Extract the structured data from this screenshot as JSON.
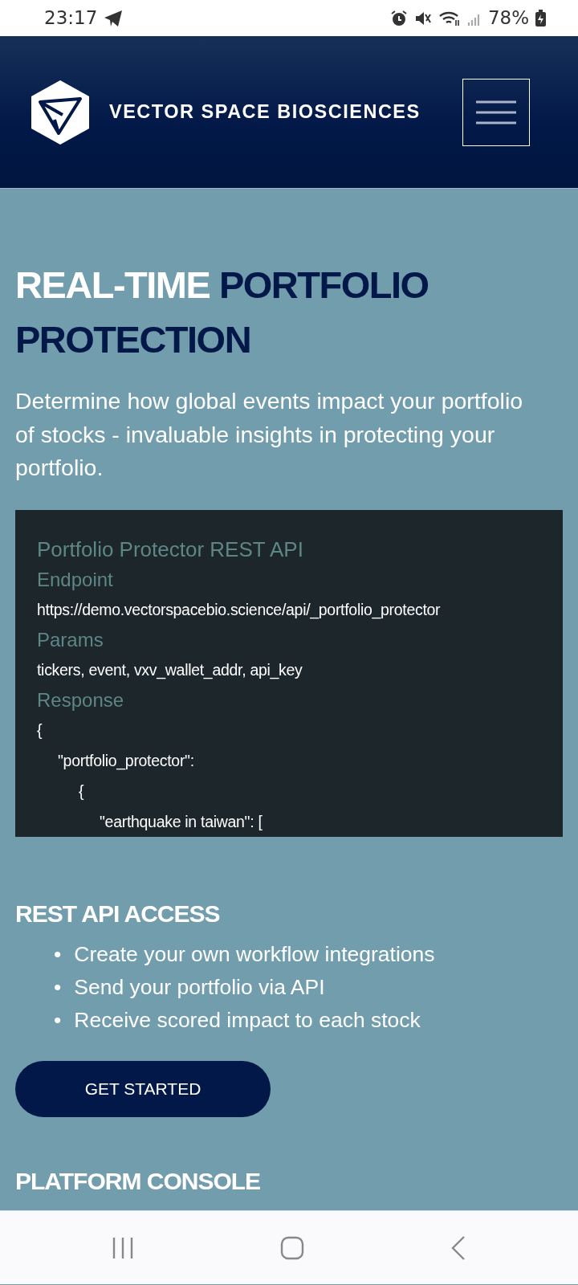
{
  "status_bar": {
    "time": "23:17",
    "battery": "78%"
  },
  "header": {
    "brand": "VECTOR SPACE BIOSCIENCES"
  },
  "hero": {
    "title_plain": "REAL-TIME",
    "title_accent": "PORTFOLIO PROTECTION",
    "description": "Determine how global events impact your portfolio of stocks - invaluable insights in protecting your portfolio."
  },
  "code_panel": {
    "lines": [
      {
        "kind": "title",
        "text": "Portfolio Protector REST API"
      },
      {
        "kind": "label",
        "text": "Endpoint"
      },
      {
        "kind": "code",
        "text": "https://demo.vectorspacebio.science/api/_portfolio_protector"
      },
      {
        "kind": "label",
        "text": "Params"
      },
      {
        "kind": "code",
        "text": "tickers, event, vxv_wallet_addr, api_key"
      },
      {
        "kind": "label",
        "text": "Response"
      },
      {
        "kind": "code",
        "text": "{",
        "children": [
          {
            "kind": "code",
            "text": "\"portfolio_protector\":",
            "children": [
              {
                "kind": "code",
                "text": "{",
                "children": [
                  {
                    "kind": "code",
                    "text": "\"earthquake in taiwan\": ["
                  }
                ]
              }
            ]
          }
        ]
      }
    ]
  },
  "rest_api": {
    "heading": "REST API ACCESS",
    "bullets": [
      {
        "marker": "•",
        "text": "Create your own workflow integrations"
      },
      {
        "marker": "•",
        "text": "Send your portfolio via API"
      },
      {
        "marker": "•",
        "text": "Receive scored impact to each stock"
      }
    ],
    "button": "GET STARTED"
  },
  "next_section": {
    "heading": "PLATFORM CONSOLE"
  }
}
